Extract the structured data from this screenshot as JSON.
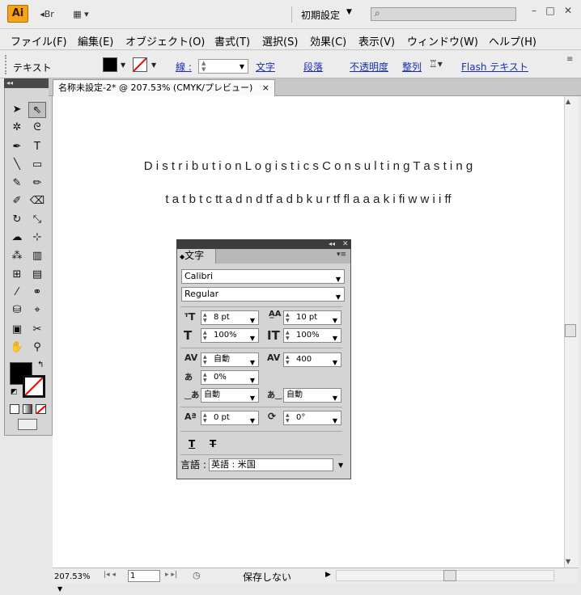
{
  "app": {
    "logo_text": "Ai",
    "bridge_label": "Br",
    "workspace_label": "初期設定"
  },
  "menu": [
    "ファイル(F)",
    "編集(E)",
    "オブジェクト(O)",
    "書式(T)",
    "選択(S)",
    "効果(C)",
    "表示(V)",
    "ウィンドウ(W)",
    "ヘルプ(H)"
  ],
  "control_bar": {
    "title": "テキスト",
    "stroke_label": "線 :",
    "links": [
      "文字",
      "段落",
      "不透明度",
      "整列",
      "Flash テキスト"
    ]
  },
  "document_tab": {
    "label": "名称未設定-2* @ 207.53% (CMYK/プレビュー)",
    "close": "×"
  },
  "canvas": {
    "line1": "D i s t r i b u t i o n   L o g i s t i c s    C o n s u l t i n g   T a s t i n g",
    "line2": "t a t b t c tt a d n d tf a d b k u r tf fl a a a k i fi w w i i ff"
  },
  "status_bar": {
    "zoom": "207.53%",
    "page": "1",
    "status_text": "保存しない"
  },
  "char_panel": {
    "tab_label": "文字",
    "font_family": "Calibri",
    "font_style": "Regular",
    "font_size": "8 pt",
    "leading": "10 pt",
    "vertical_scale": "100%",
    "horizontal_scale": "100%",
    "kerning": "自動",
    "tracking": "400",
    "tsume": "0%",
    "aki_left": "自動",
    "aki_right": "自動",
    "baseline_shift": "0 pt",
    "rotation": "0°",
    "language_label": "言語 :",
    "language": "英語 : 米国"
  },
  "colors": {
    "fill": "#000000",
    "stroke_none": "#ff0000",
    "link": "#1b2fb0"
  }
}
